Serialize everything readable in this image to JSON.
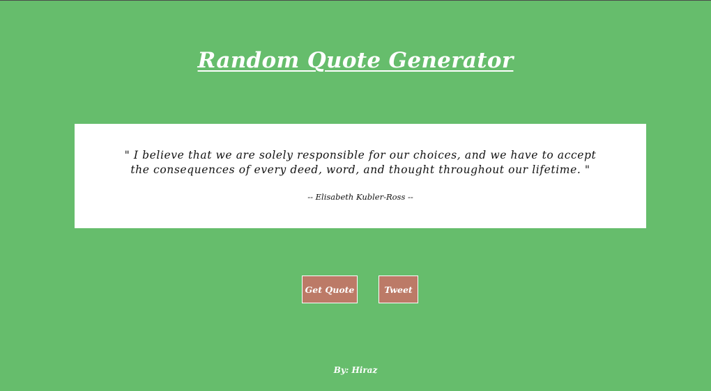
{
  "page": {
    "title": "Random Quote Generator"
  },
  "quote": {
    "text": "\" I believe that we are solely responsible for our choices, and we have to accept the consequences of every deed, word, and thought throughout our lifetime. \"",
    "author": "-- Elisabeth Kubler-Ross --"
  },
  "buttons": {
    "get_quote_label": "Get Quote",
    "tweet_label": "Tweet"
  },
  "footer": {
    "credit": "By: Hiraz"
  },
  "colors": {
    "background": "#66bd6c",
    "button": "#bc7a67",
    "card": "#ffffff"
  }
}
